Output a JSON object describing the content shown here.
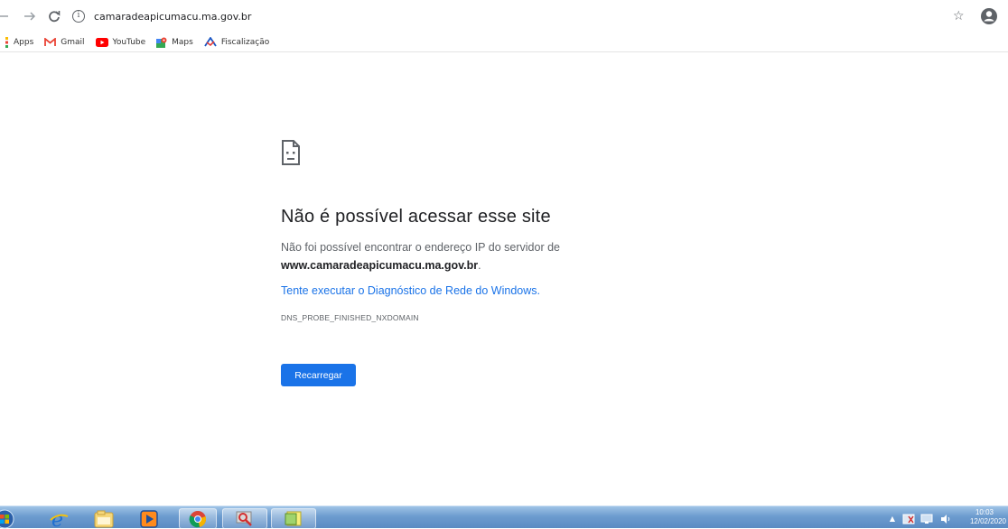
{
  "toolbar": {
    "back_icon": "back-arrow-icon",
    "forward_icon": "forward-arrow-icon",
    "reload_icon": "reload-icon",
    "info_glyph": "i",
    "url": "camaradeapicumacu.ma.gov.br"
  },
  "bookmarks": [
    {
      "label": "Apps",
      "icon": "apps-grid-icon"
    },
    {
      "label": "Gmail",
      "icon": "gmail-icon"
    },
    {
      "label": "YouTube",
      "icon": "youtube-icon"
    },
    {
      "label": "Maps",
      "icon": "maps-icon"
    },
    {
      "label": "Fiscalização",
      "icon": "fiscalizacao-icon"
    }
  ],
  "error": {
    "title": "Não é possível acessar esse site",
    "desc_prefix": "Não foi possível encontrar o endereço IP do servidor de",
    "desc_host": "www.camaradeapicumacu.ma.gov.br",
    "desc_suffix": ".",
    "link": "Tente executar o Diagnóstico de Rede do Windows.",
    "code": "DNS_PROBE_FINISHED_NXDOMAIN",
    "reload_label": "Recarregar"
  },
  "taskbar": {
    "time": "10:03",
    "date": "12/02/2020"
  },
  "colors": {
    "accent": "#1a73e8",
    "text": "#202124",
    "muted": "#5f6368"
  }
}
